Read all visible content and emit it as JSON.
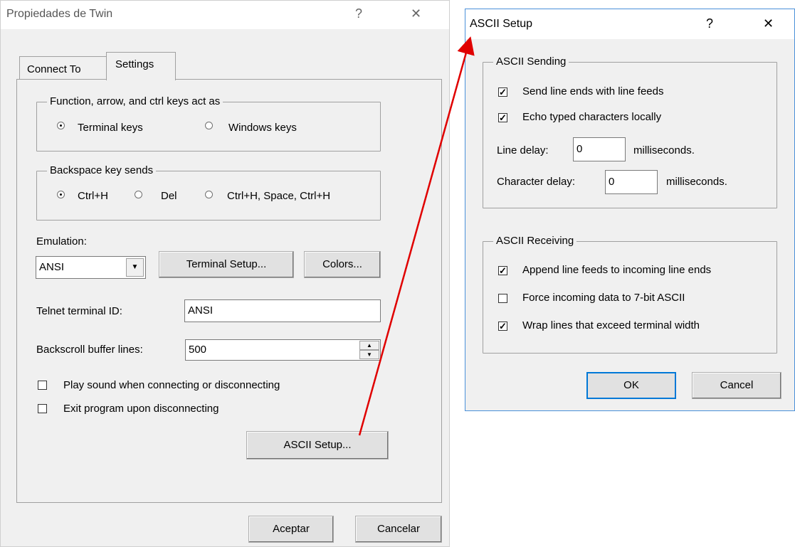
{
  "left_dialog": {
    "title": "Propiedades de Twin",
    "help_glyph": "?",
    "close_glyph": "✕",
    "tabs": [
      {
        "label": "Connect To"
      },
      {
        "label": "Settings"
      }
    ],
    "keys_group": {
      "legend": "Function, arrow, and ctrl keys act as",
      "options": [
        "Terminal keys",
        "Windows keys"
      ],
      "selected": "Terminal keys"
    },
    "backspace_group": {
      "legend": "Backspace key sends",
      "options": [
        "Ctrl+H",
        "Del",
        "Ctrl+H, Space, Ctrl+H"
      ],
      "selected": "Ctrl+H"
    },
    "emulation": {
      "label": "Emulation:",
      "value": "ANSI",
      "terminal_setup_label": "Terminal Setup...",
      "colors_label": "Colors..."
    },
    "telnet": {
      "label": "Telnet terminal ID:",
      "value": "ANSI"
    },
    "backscroll": {
      "label": "Backscroll buffer lines:",
      "value": "500"
    },
    "play_sound": {
      "label": "Play sound when connecting or disconnecting",
      "checked": false
    },
    "exit_program": {
      "label": "Exit program upon disconnecting",
      "checked": false
    },
    "ascii_setup_label": "ASCII Setup...",
    "ok_label": "Aceptar",
    "cancel_label": "Cancelar"
  },
  "right_dialog": {
    "title": "ASCII Setup",
    "help_glyph": "?",
    "close_glyph": "✕",
    "sending": {
      "legend": "ASCII Sending",
      "send_line_ends": {
        "label": "Send line ends with line feeds",
        "checked": true
      },
      "echo_typed": {
        "label": "Echo typed characters locally",
        "checked": true
      },
      "line_delay": {
        "label": "Line delay:",
        "value": "0",
        "unit": "milliseconds."
      },
      "char_delay": {
        "label": "Character delay:",
        "value": "0",
        "unit": "milliseconds."
      }
    },
    "receiving": {
      "legend": "ASCII Receiving",
      "append_lf": {
        "label": "Append line feeds to incoming line ends",
        "checked": true
      },
      "force_7bit": {
        "label": "Force incoming data to 7-bit ASCII",
        "checked": false
      },
      "wrap_lines": {
        "label": "Wrap lines that exceed terminal width",
        "checked": true
      }
    },
    "ok_label": "OK",
    "cancel_label": "Cancel"
  },
  "glyphs": {
    "check": "✓",
    "dropdown": "▼",
    "spin_up": "▲",
    "spin_down": "▼"
  },
  "colors": {
    "arrow": "#e00000",
    "accent_border": "#0078d7"
  }
}
